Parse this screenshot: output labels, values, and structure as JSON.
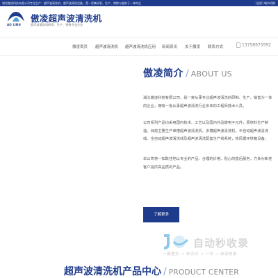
{
  "topbar": {
    "intro": "湖北傲凌科技有限公司专业生产：超声波清洗机、超声波清洗设备，是一家集研发、生产、销售与服务于一体的企",
    "links": "[全屏] 城市切换"
  },
  "header": {
    "logo_text": "AO LING",
    "brand_title": "傲凌超声波清洗机",
    "brand_sub": "超声波清洗机研发、生产、销售专业企业"
  },
  "nav": {
    "items": [
      "傲凌首页",
      "超声波清洗机",
      "超声波清洗机应用",
      "新闻资讯",
      "关于傲凌",
      "联系方式"
    ],
    "phone": "13758975992"
  },
  "about": {
    "title_cn": "傲凌简介",
    "title_sep": "/",
    "title_en": "ABOUT US",
    "p1": "湖北傲凌科技有限公司，是一家从事专业超声波清洗的研制、生产、销售为一体的企业，拥有一批从事超声波清洗行业多年的工程师技术人员。",
    "p2": "公司系列产品均采用国内技术、工艺以及国内外品牌电子元件，原材料生产制造。目前主要生产单槽超声波清洗机、多槽超声波清洗机、半自动超声波清洗线、全自动超声波清洗线及超声波清洗配套生产线系统，热风循环烘箱设备。",
    "p3": "本公司将一如既往地以专业的产品、合理的价格、贴心的售后服务，力争为新老客户提供高品质的产品。",
    "more_label": "了解更多"
  },
  "watermark": {
    "text": "自动秒收录",
    "slogan": "一键提交 → 未访问 → 一次 → 自动收录"
  },
  "product": {
    "title_cn": "超声波清洗机产品中心",
    "title_sep": "/",
    "title_en": "PRODUCT CENTER"
  },
  "colors": {
    "brand_blue": "#1f3c8c",
    "watermark_gray": "#d7d7d7"
  }
}
